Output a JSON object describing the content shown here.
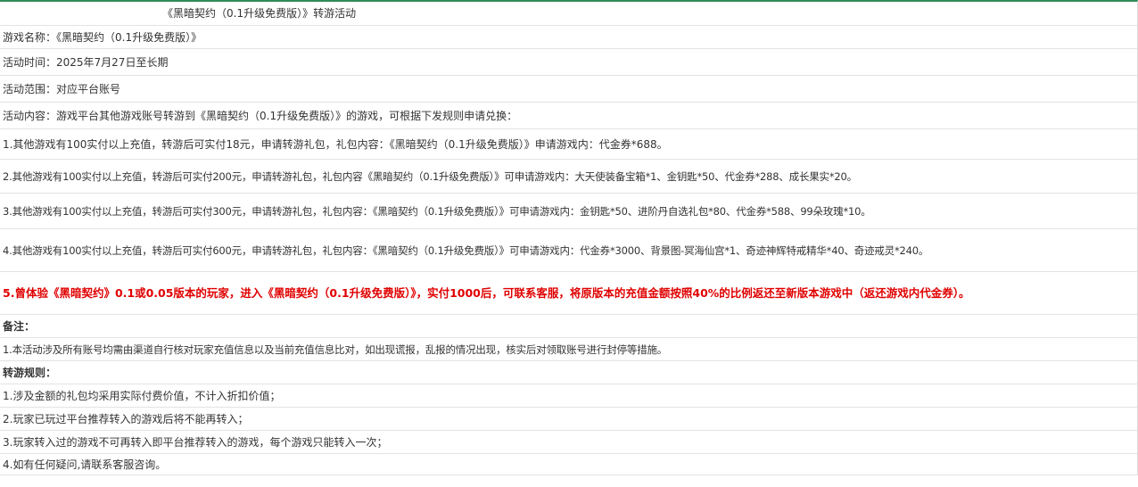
{
  "title": "《黑暗契约（0.1升级免费版）》转游活动",
  "game_name": "游戏名称：《黑暗契约（0.1升级免费版）》",
  "activity_time": "活动时间：2025年7月27日至长期",
  "activity_scope": "活动范围：对应平台账号",
  "activity_content": "活动内容：游戏平台其他游戏账号转游到《黑暗契约（0.1升级免费版）》的游戏，可根据下发规则申请兑换：",
  "rules": [
    "1.其他游戏有100实付以上充值，转游后可实付18元，申请转游礼包，礼包内容：《黑暗契约（0.1升级免费版）》申请游戏内：代金券*688。",
    "2.其他游戏有100实付以上充值，转游后可实付200元，申请转游礼包，礼包内容《黑暗契约（0.1升级免费版）》可申请游戏内：大天使装备宝箱*1、金钥匙*50、代金券*288、成长果实*20。",
    "3.其他游戏有100实付以上充值，转游后可实付300元，申请转游礼包，礼包内容：《黑暗契约（0.1升级免费版）》可申请游戏内：金钥匙*50、进阶丹自选礼包*80、代金券*588、99朵玫瑰*10。",
    "4.其他游戏有100实付以上充值，转游后可实付600元，申请转游礼包，礼包内容：《黑暗契约（0.1升级免费版）》可申请游戏内：代金券*3000、背景图-冥海仙宫*1、奇迹神辉特戒精华*40、奇迹戒灵*240。"
  ],
  "rule5": "5.曾体验《黑暗契约》0.1或0.05版本的玩家，进入《黑暗契约（0.1升级免费版）》，实付1000后，可联系客服，将原版本的充值金额按照40%的比例返还至新版本游戏中（返还游戏内代金券）。",
  "notes_title": "备注：",
  "notes": [
    "1.本活动涉及所有账号均需由渠道自行核对玩家充值信息以及当前充值信息比对，如出现谎报，乱报的情况出现，核实后对领取账号进行封停等措施。"
  ],
  "transfer_rules_title": "转游规则：",
  "transfer_rules": [
    "1.涉及金额的礼包均采用实际付费价值，不计入折扣价值；",
    "2.玩家已玩过平台推荐转入的游戏后将不能再转入；",
    "3.玩家转入过的游戏不可再转入即平台推荐转入的游戏，每个游戏只能转入一次；",
    "4.如有任何疑问,请联系客服咨询。"
  ],
  "colors": {
    "top_border": "#2e8b57",
    "highlight_text": "#e00000",
    "body_text": "#333333",
    "row_border": "#e3e3e3"
  }
}
